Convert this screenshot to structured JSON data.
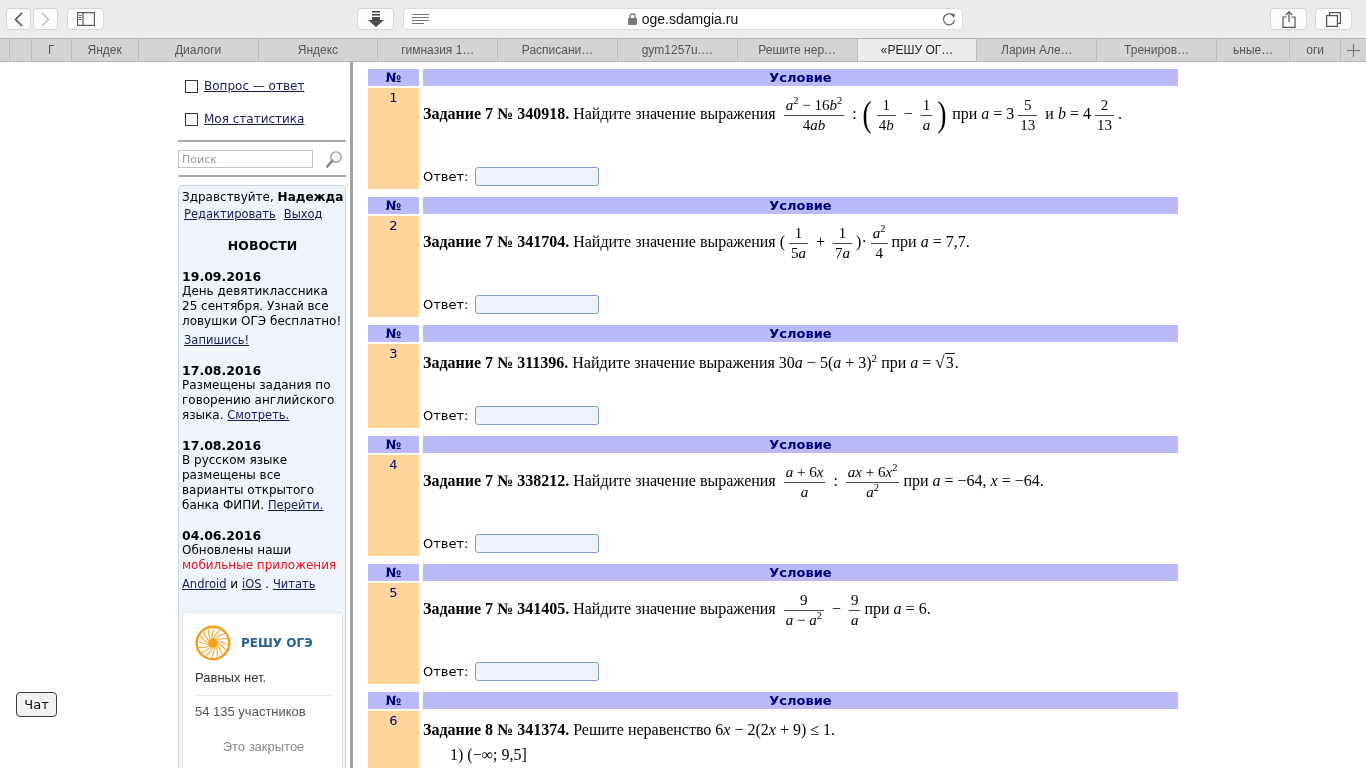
{
  "browser": {
    "nav": [
      {
        "kind": "back",
        "disabled": false
      },
      {
        "kind": "forward",
        "disabled": true
      }
    ],
    "address": {
      "url": "oge.sdamgia.ru",
      "secure": true
    },
    "tabs": [
      {
        "label": "Г",
        "kind": "stacked",
        "selected": false
      },
      {
        "label": "Яндек",
        "kind": "stacked",
        "selected": false
      },
      {
        "label": "Диалоги",
        "kind": "full",
        "selected": false
      },
      {
        "label": "Яндекс",
        "kind": "full",
        "selected": false
      },
      {
        "label": "гимназия 1…",
        "kind": "full",
        "selected": false
      },
      {
        "label": "Расписани…",
        "kind": "full",
        "selected": false
      },
      {
        "label": "gym1257u.…",
        "kind": "full",
        "selected": false
      },
      {
        "label": "Решите нер…",
        "kind": "full",
        "selected": false
      },
      {
        "label": "«РЕШУ ОГ…",
        "kind": "full",
        "selected": true
      },
      {
        "label": "Ларин Але…",
        "kind": "full",
        "selected": false
      },
      {
        "label": "Трениров…",
        "kind": "full",
        "selected": false
      },
      {
        "label": "ьные…",
        "kind": "stacked",
        "selected": false
      },
      {
        "label": "оги",
        "kind": "stacked",
        "selected": false
      }
    ]
  },
  "sidebar": {
    "options": [
      {
        "label": "Вопрос — ответ",
        "checked": false
      },
      {
        "label": "Моя статистика",
        "checked": false
      }
    ],
    "search": {
      "placeholder": "Поиск"
    },
    "user": {
      "greeting": "Здравствуйте, **Надежда**",
      "links": [
        "Редактировать",
        "Выход"
      ]
    },
    "news_title": "НОВОСТИ",
    "news": [
      {
        "date": "19.09.2016",
        "paragraphs": [
          [
            {
              "kind": "text",
              "text": "День девятиклассника 25 сентября. Узнай все ловушки ОГЭ бесплатно!"
            }
          ],
          [
            {
              "kind": "link",
              "text": "Запишись!"
            }
          ]
        ]
      },
      {
        "date": "17.08.2016",
        "paragraphs": [
          [
            {
              "kind": "text",
              "text": "Размещены задания по говорению английского языка."
            },
            {
              "kind": "link",
              "text": "Смотреть."
            }
          ]
        ]
      },
      {
        "date": "17.08.2016",
        "paragraphs": [
          [
            {
              "kind": "text",
              "text": "В русском языке размещены все варианты открытого банка ФИПИ."
            },
            {
              "kind": "link",
              "text": "Перейти."
            }
          ]
        ]
      },
      {
        "date": "04.06.2016",
        "paragraphs": [
          [
            {
              "kind": "text",
              "text": "Обновлены наши"
            },
            {
              "kind": "highlight",
              "text": "мобильные приложения"
            }
          ],
          [
            {
              "kind": "link",
              "text": "Android"
            },
            {
              "kind": "text",
              "text": "и"
            },
            {
              "kind": "link",
              "text": "iOS"
            },
            {
              "kind": "text",
              "text": "."
            },
            {
              "kind": "link",
              "text": "Читать"
            }
          ]
        ]
      }
    ],
    "community": {
      "brand": "РЕШУ ОГЭ",
      "tagline": "Равных нет.",
      "members": "54 135 участников",
      "note": "Это закрытое"
    }
  },
  "tasks": [
    {
      "number": "1",
      "number_heading": "№",
      "condition_heading": "Условие",
      "statement": [
        {
          "kind": "text",
          "text": "**Задание 7 № 340918.** Найдите значение выражения "
        },
        {
          "kind": "frac",
          "num": "a$^{2}$ − 16b$^{2}$",
          "den": "4ab"
        },
        {
          "kind": "math",
          "text": " : "
        },
        {
          "kind": "paren",
          "open": "(",
          "close": ")",
          "parts": [
            {
              "kind": "frac",
              "num": "1",
              "den": "4b"
            },
            {
              "kind": "math",
              "text": " − "
            },
            {
              "kind": "frac",
              "num": "1",
              "den": "a"
            }
          ]
        },
        {
          "kind": "text",
          "text": " при "
        },
        {
          "kind": "math",
          "text": "a = 3"
        },
        {
          "kind": "frac",
          "num": "5",
          "den": "13"
        },
        {
          "kind": "text",
          "text": " и "
        },
        {
          "kind": "math",
          "text": "b = 4"
        },
        {
          "kind": "frac",
          "num": "2",
          "den": "13"
        },
        {
          "kind": "math",
          "text": "."
        }
      ],
      "answer": {
        "label": "Ответ:"
      }
    },
    {
      "number": "2",
      "number_heading": "№",
      "condition_heading": "Условие",
      "statement": [
        {
          "kind": "text",
          "text": "**Задание 7 № 341704.** Найдите значение выражения "
        },
        {
          "kind": "math",
          "text": "("
        },
        {
          "kind": "frac",
          "num": "1",
          "den": "5a"
        },
        {
          "kind": "math",
          "text": " + "
        },
        {
          "kind": "frac",
          "num": "1",
          "den": "7a"
        },
        {
          "kind": "math",
          "text": ")·"
        },
        {
          "kind": "frac",
          "num": "a$^{2}$",
          "den": "4"
        },
        {
          "kind": "text",
          "text": "при "
        },
        {
          "kind": "math",
          "text": "a = 7,7."
        }
      ],
      "answer": {
        "label": "Ответ:"
      }
    },
    {
      "number": "3",
      "number_heading": "№",
      "condition_heading": "Условие",
      "statement": [
        {
          "kind": "text",
          "text": "**Задание 7 № 311396.** Найдите значение выражения "
        },
        {
          "kind": "math",
          "text": "30a − 5(a + 3)$^{2}$"
        },
        {
          "kind": "text",
          "text": " при "
        },
        {
          "kind": "math",
          "text": "a = "
        },
        {
          "kind": "sqrt",
          "sign": "√",
          "text": "3"
        },
        {
          "kind": "math",
          "text": "."
        }
      ],
      "answer": {
        "label": "Ответ:"
      }
    },
    {
      "number": "4",
      "number_heading": "№",
      "condition_heading": "Условие",
      "statement": [
        {
          "kind": "text",
          "text": "**Задание 7 № 338212.** Найдите значение выражения "
        },
        {
          "kind": "frac",
          "num": "a + 6x",
          "den": "a"
        },
        {
          "kind": "math",
          "text": " : "
        },
        {
          "kind": "frac",
          "num": "ax + 6x$^{2}$",
          "den": "a$^{2}$"
        },
        {
          "kind": "text",
          "text": "при "
        },
        {
          "kind": "math",
          "text": "a = −64, x = −64."
        }
      ],
      "answer": {
        "label": "Ответ:"
      }
    },
    {
      "number": "5",
      "number_heading": "№",
      "condition_heading": "Условие",
      "statement": [
        {
          "kind": "text",
          "text": "**Задание 7 № 341405.** Найдите значение выражения "
        },
        {
          "kind": "frac",
          "num": "9",
          "den": "a − a$^{2}$"
        },
        {
          "kind": "math",
          "text": " − "
        },
        {
          "kind": "frac",
          "num": "9",
          "den": "a"
        },
        {
          "kind": "text",
          "text": "при "
        },
        {
          "kind": "math",
          "text": "a = 6."
        }
      ],
      "answer": {
        "label": "Ответ:"
      }
    },
    {
      "number": "6",
      "number_heading": "№",
      "condition_heading": "Условие",
      "statement": [
        {
          "kind": "text",
          "text": "**Задание 8 № 341374.** Решите неравенство "
        },
        {
          "kind": "math",
          "text": "6x − 2(2x + 9) ≤ 1."
        }
      ],
      "options": [
        "1) (−∞; 9,5]"
      ]
    }
  ],
  "chat_button": {
    "label": "Чат"
  }
}
